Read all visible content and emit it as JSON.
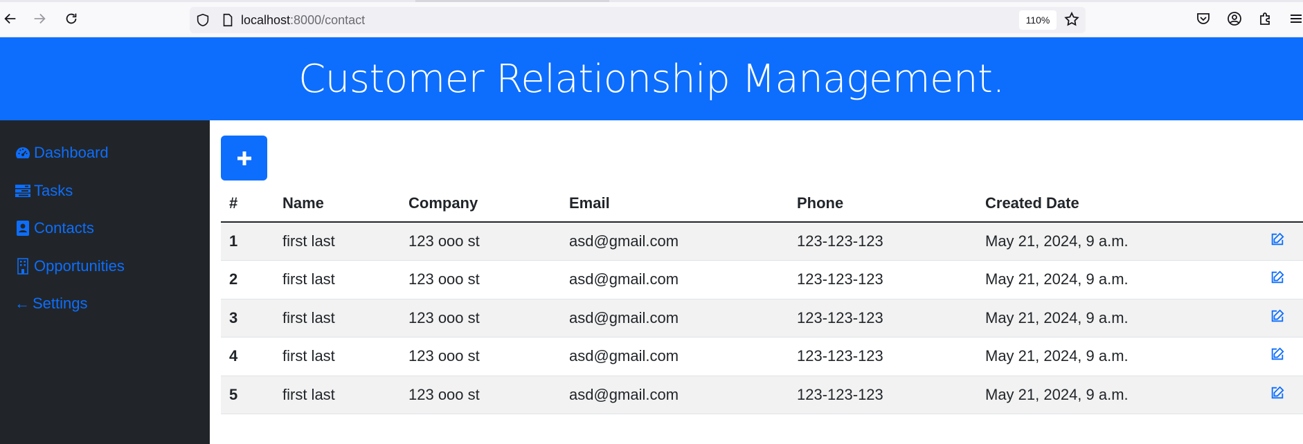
{
  "browser": {
    "url_host": "localhost",
    "url_path": ":8000/contact",
    "zoom": "110%"
  },
  "header": {
    "title": "Customer Relationship Management."
  },
  "sidebar": {
    "items": [
      {
        "label": "Dashboard",
        "icon": "gauge-icon"
      },
      {
        "label": "Tasks",
        "icon": "tasks-icon"
      },
      {
        "label": "Contacts",
        "icon": "contact-book-icon"
      },
      {
        "label": "Opportunities",
        "icon": "building-icon"
      },
      {
        "label": "Settings",
        "icon": "arrow-left-icon"
      }
    ]
  },
  "toolbar": {
    "add_icon": "plus-icon"
  },
  "table": {
    "headers": [
      "#",
      "Name",
      "Company",
      "Email",
      "Phone",
      "Created Date",
      ""
    ],
    "rows": [
      {
        "idx": "1",
        "name": "first last",
        "company": "123 ooo st",
        "email": "asd@gmail.com",
        "phone": "123-123-123",
        "created": "May 21, 2024, 9 a.m."
      },
      {
        "idx": "2",
        "name": "first last",
        "company": "123 ooo st",
        "email": "asd@gmail.com",
        "phone": "123-123-123",
        "created": "May 21, 2024, 9 a.m."
      },
      {
        "idx": "3",
        "name": "first last",
        "company": "123 ooo st",
        "email": "asd@gmail.com",
        "phone": "123-123-123",
        "created": "May 21, 2024, 9 a.m."
      },
      {
        "idx": "4",
        "name": "first last",
        "company": "123 ooo st",
        "email": "asd@gmail.com",
        "phone": "123-123-123",
        "created": "May 21, 2024, 9 a.m."
      },
      {
        "idx": "5",
        "name": "first last",
        "company": "123 ooo st",
        "email": "asd@gmail.com",
        "phone": "123-123-123",
        "created": "May 21, 2024, 9 a.m."
      }
    ]
  },
  "colors": {
    "primary": "#0d6efd",
    "sidebar_bg": "#212529",
    "stripe": "#f2f2f2"
  }
}
